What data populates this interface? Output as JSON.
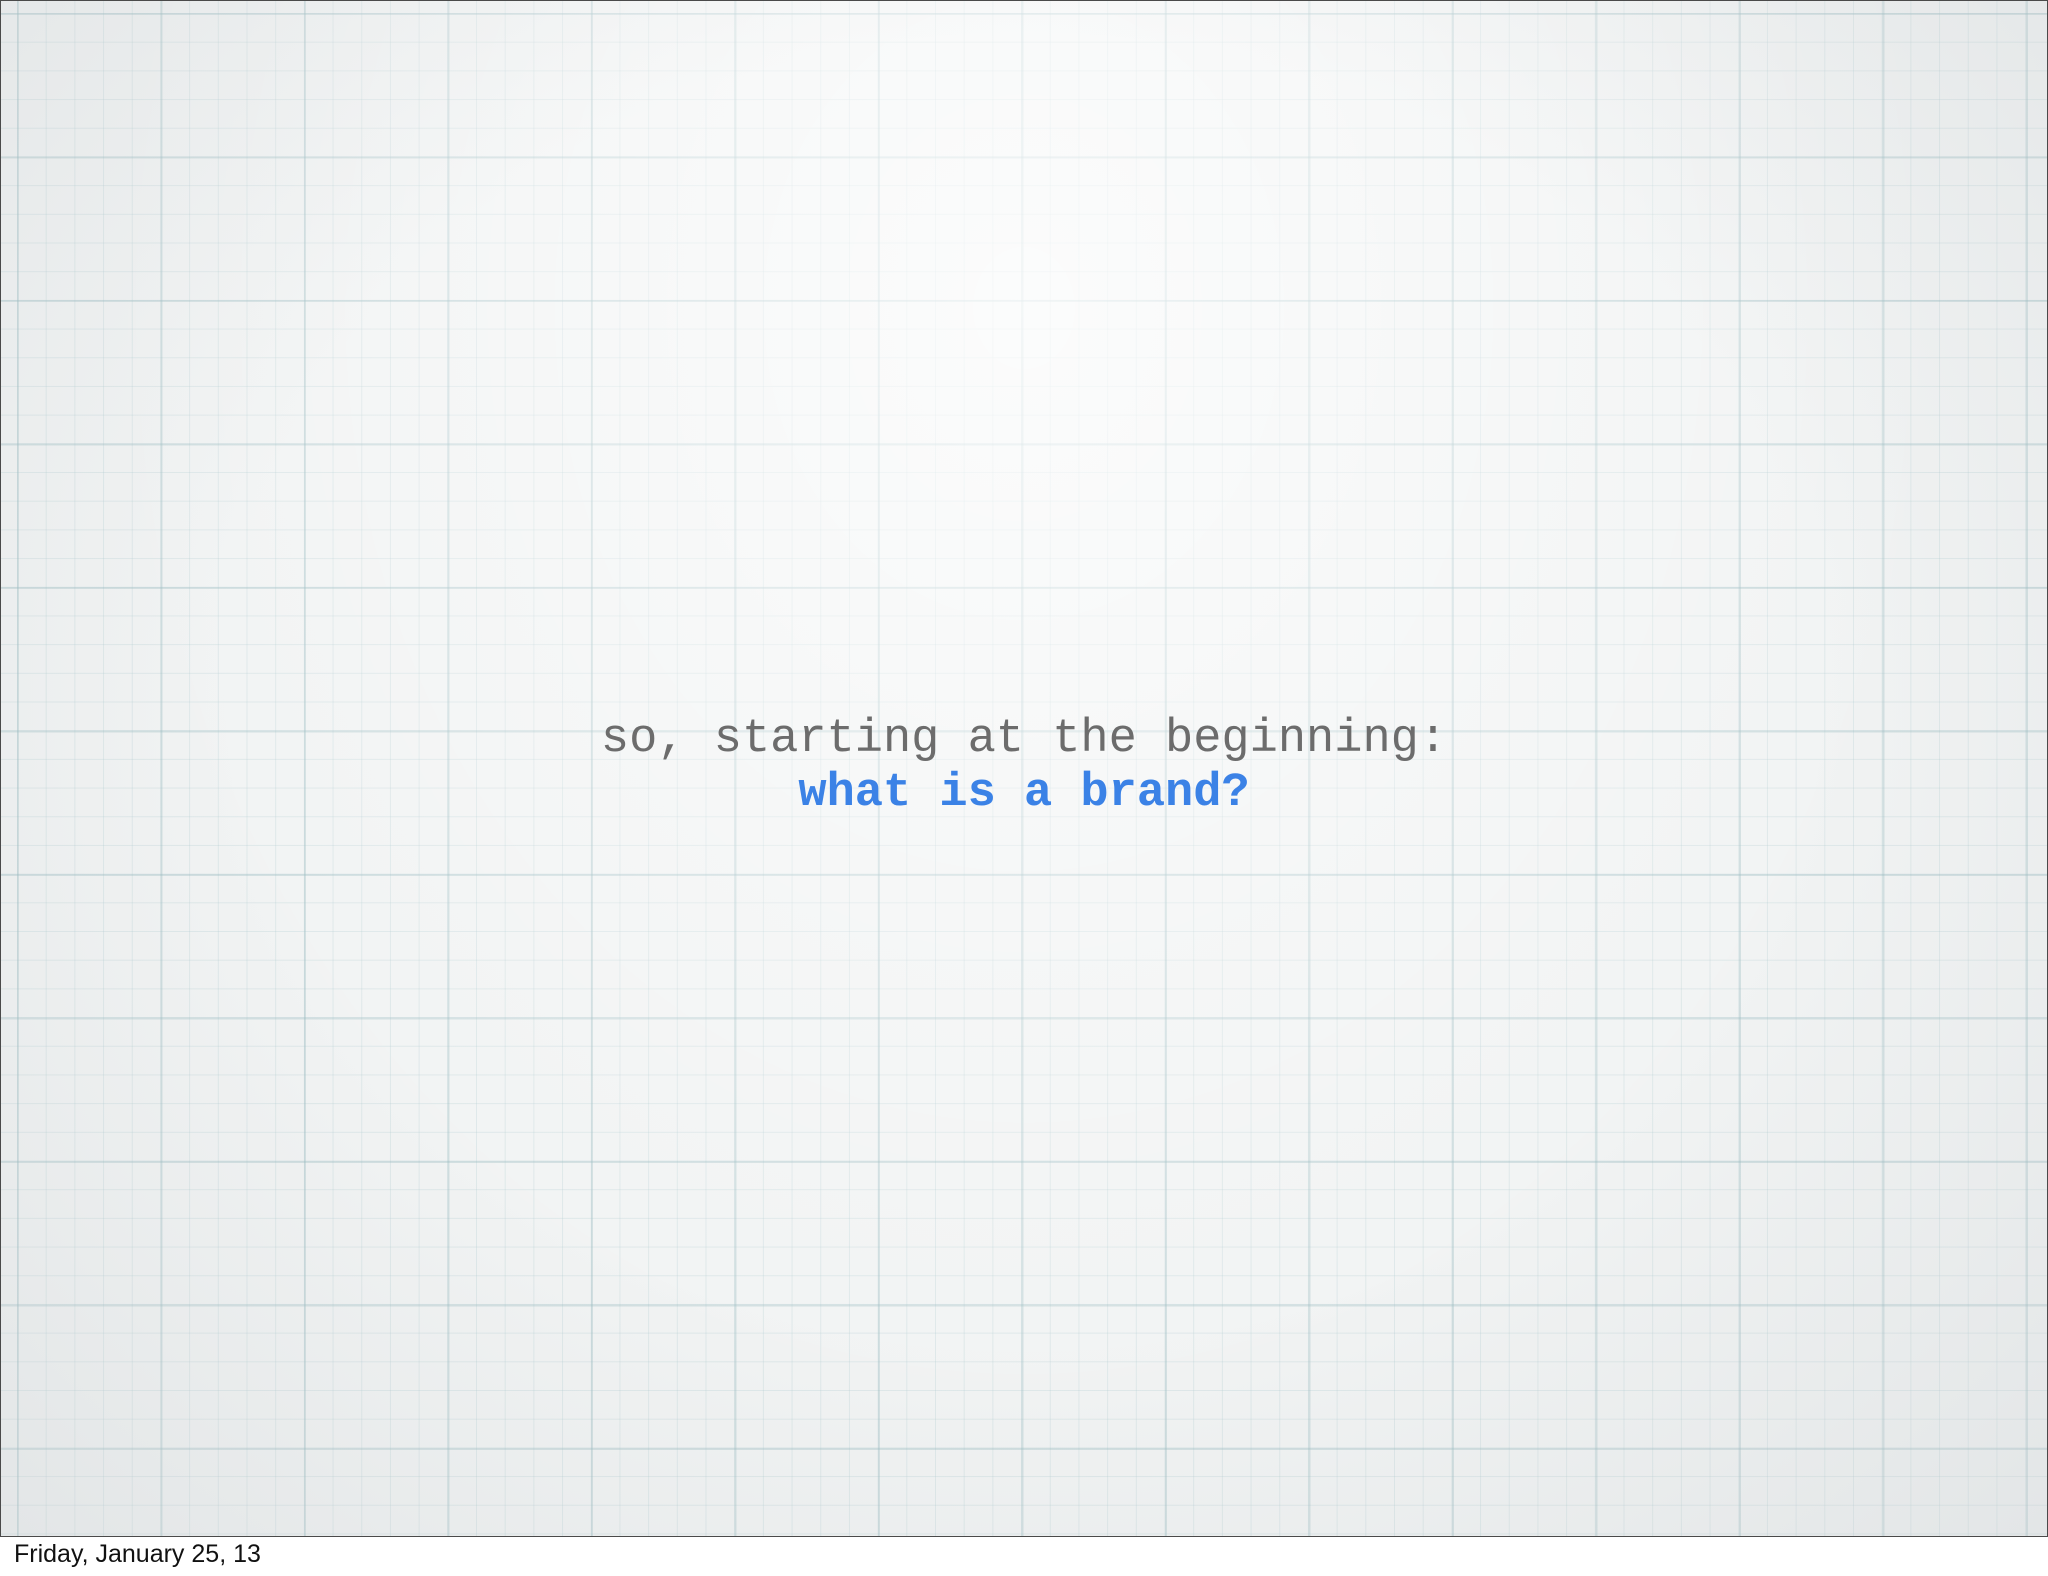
{
  "slide": {
    "intro_text": "so, starting at the beginning:",
    "question_text": "what is a brand?",
    "question_color": "#3b82e6"
  },
  "footer": {
    "date_text": "Friday, January 25, 13"
  }
}
